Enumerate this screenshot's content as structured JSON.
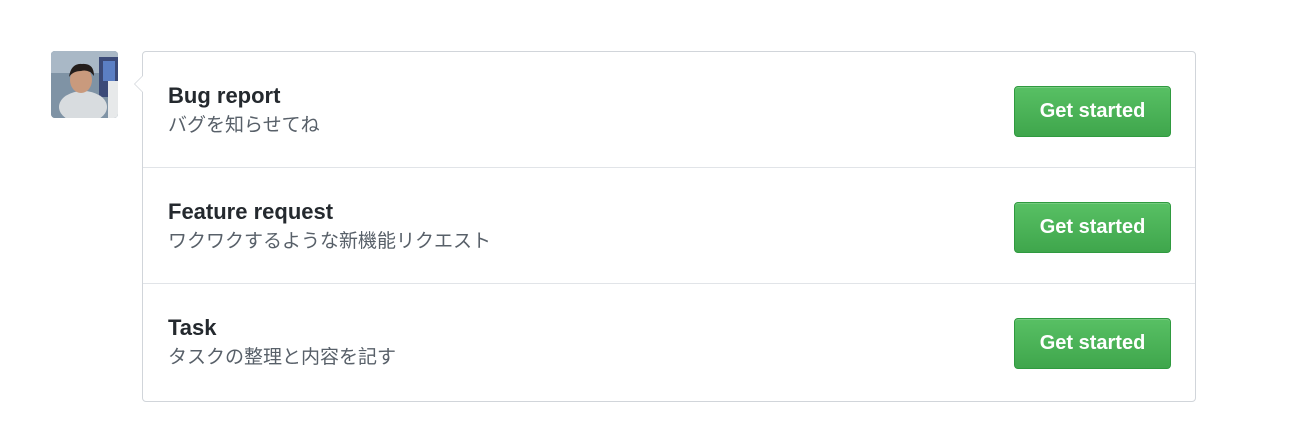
{
  "avatar": {
    "icon": "user-avatar-photo"
  },
  "templates": [
    {
      "title": "Bug report",
      "description": "バグを知らせてね",
      "button_label": "Get started"
    },
    {
      "title": "Feature request",
      "description": "ワクワクするような新機能リクエスト",
      "button_label": "Get started"
    },
    {
      "title": "Task",
      "description": "タスクの整理と内容を記す",
      "button_label": "Get started"
    }
  ],
  "colors": {
    "button": "#46b552",
    "border": "#d1d5da",
    "title": "#24292e",
    "description": "#586069"
  }
}
